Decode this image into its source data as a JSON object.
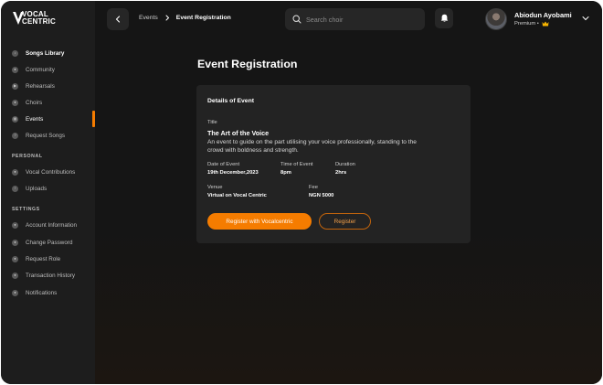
{
  "app": {
    "logo_line1": "VOCAL",
    "logo_line2": "CENTRIC",
    "accent_color": "#f57c00"
  },
  "sidebar": {
    "main_items": [
      {
        "label": "Songs Library",
        "icon": "music-icon",
        "glyph": "♪"
      },
      {
        "label": "Community",
        "icon": "community-icon",
        "glyph": "●"
      },
      {
        "label": "Rehearsals",
        "icon": "rehearsal-icon",
        "glyph": "▶"
      },
      {
        "label": "Choirs",
        "icon": "choir-icon",
        "glyph": "●"
      },
      {
        "label": "Events",
        "icon": "events-icon",
        "glyph": "▦",
        "active": true
      },
      {
        "label": "Request Songs",
        "icon": "request-icon",
        "glyph": "?"
      }
    ],
    "personal_label": "PERSONAL",
    "personal_items": [
      {
        "label": "Vocal Contributions",
        "icon": "microphone-icon",
        "glyph": "●"
      },
      {
        "label": "Uploads",
        "icon": "upload-icon",
        "glyph": "↑"
      }
    ],
    "settings_label": "SETTINGS",
    "settings_items": [
      {
        "label": "Account Information",
        "icon": "user-icon",
        "glyph": "●"
      },
      {
        "label": "Change Password",
        "icon": "lock-icon",
        "glyph": "●"
      },
      {
        "label": "Request Role",
        "icon": "role-icon",
        "glyph": "●"
      },
      {
        "label": "Transaction History",
        "icon": "history-icon",
        "glyph": "●"
      },
      {
        "label": "Notifications",
        "icon": "bell-icon",
        "glyph": "●"
      }
    ]
  },
  "header": {
    "breadcrumb_parent": "Events",
    "breadcrumb_current": "Event Registration",
    "search_placeholder": "Search choir",
    "user_name": "Abiodun Ayobami",
    "user_plan": "Premium •"
  },
  "main": {
    "page_title": "Event Registration",
    "card": {
      "heading": "Details of Event",
      "title_label": "Title",
      "event_name": "The Art of the Voice",
      "event_description": "An event to guide on the part utilising your voice professionally, standing to the crowd with boldness and strength.",
      "date_label": "Date of Event",
      "date_value": "19th December,2023",
      "time_label": "Time of Event",
      "time_value": "8pm",
      "duration_label": "Duration",
      "duration_value": "2hrs",
      "venue_label": "Venue",
      "venue_value": "Virtual on Vocal Centric",
      "fee_label": "Fee",
      "fee_value": "NGN 5000",
      "primary_button": "Register with Vocalcentric",
      "secondary_button": "Register"
    }
  }
}
